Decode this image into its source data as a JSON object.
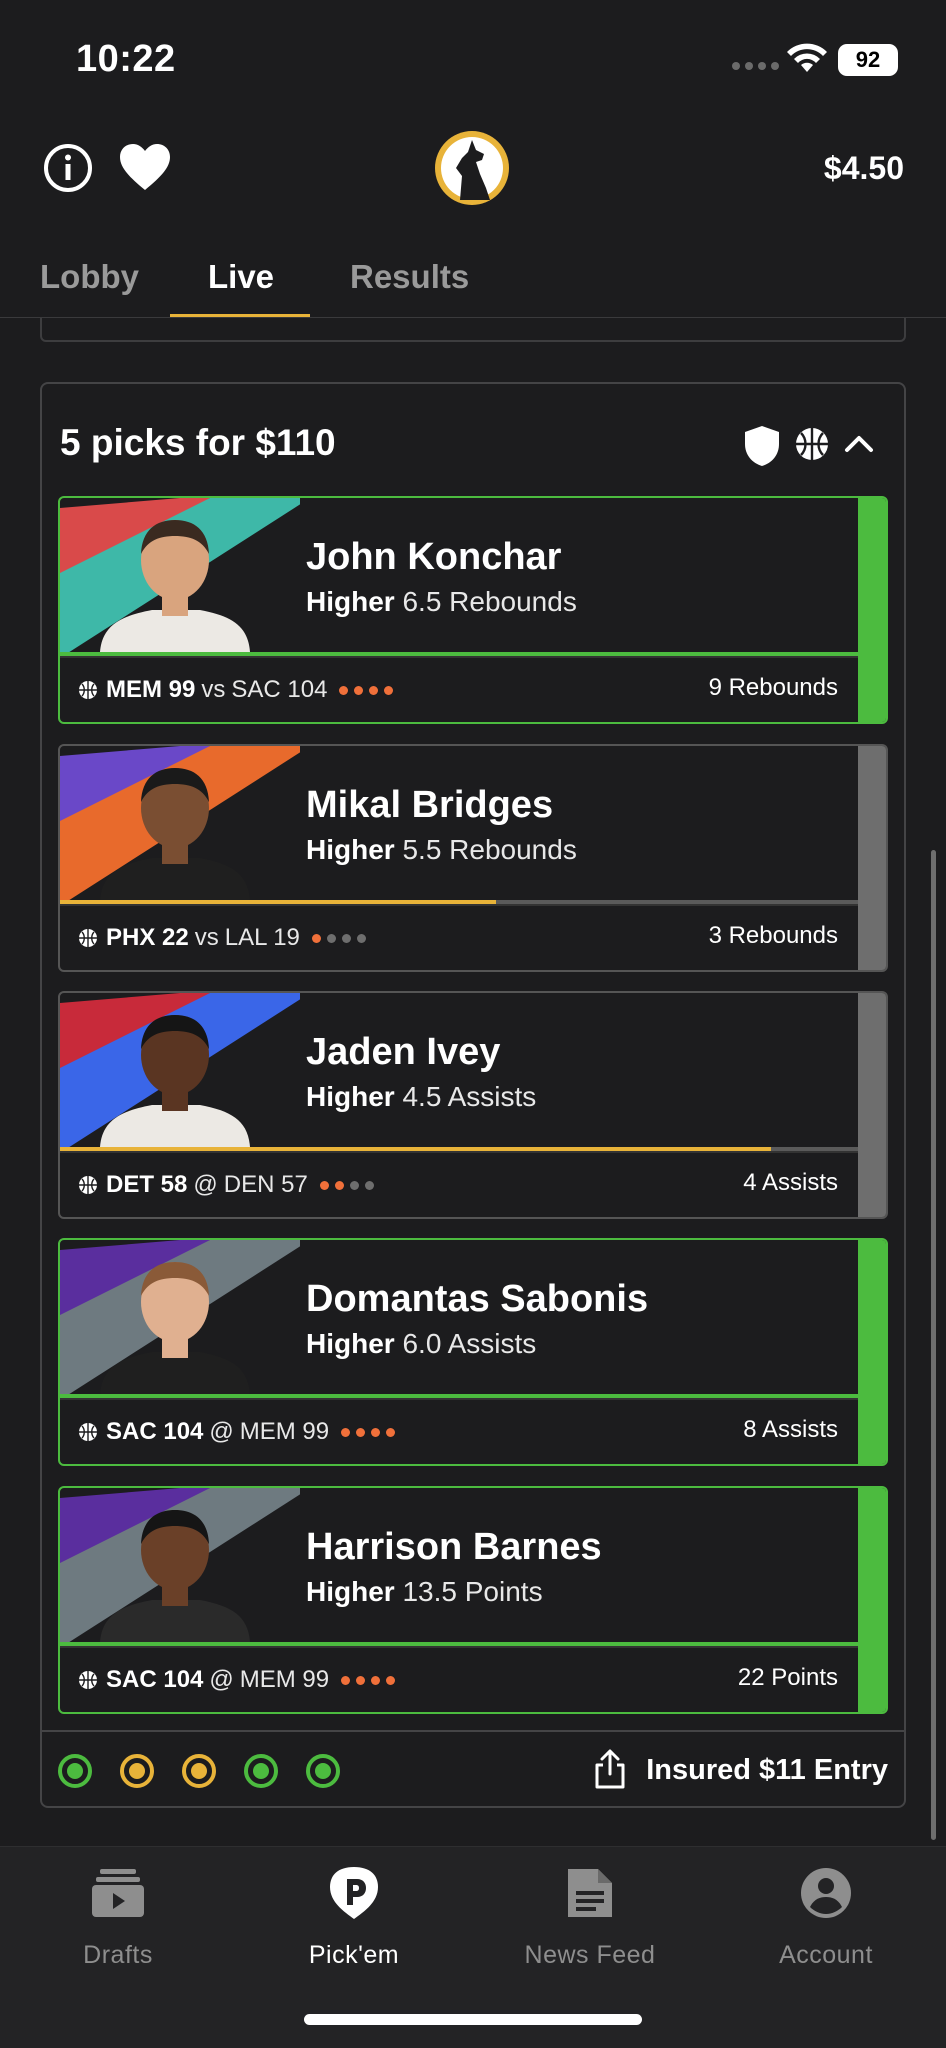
{
  "status_bar": {
    "time": "10:22",
    "battery": "92"
  },
  "header": {
    "balance": "$4.50"
  },
  "tabs": [
    {
      "label": "Lobby",
      "active": false
    },
    {
      "label": "Live",
      "active": true
    },
    {
      "label": "Results",
      "active": false
    }
  ],
  "entry": {
    "title": "5 picks for $110",
    "footer": {
      "insured_label": "Insured $11 Entry",
      "pick_statuses": [
        "won",
        "in-progress",
        "in-progress",
        "won",
        "won"
      ]
    },
    "picks": [
      {
        "player": "John Konchar",
        "direction": "Higher",
        "line": "6.5 Rebounds",
        "team": "MEM 99",
        "sep": "vs",
        "opp": "SAC 104",
        "period_dots_on": 4,
        "current_stat": "9 Rebounds",
        "progress": 1.0,
        "status": "won",
        "stripe_colors": [
          "#d94a4a",
          "#3eb8a8"
        ],
        "jersey_color": "#ece9e4",
        "skin_color": "#d9a47e",
        "hair_color": "#3a2a20"
      },
      {
        "player": "Mikal Bridges",
        "direction": "Higher",
        "line": "5.5 Rebounds",
        "team": "PHX 22",
        "sep": "vs",
        "opp": "LAL 19",
        "period_dots_on": 1,
        "current_stat": "3 Rebounds",
        "progress": 0.545,
        "status": "in-progress",
        "stripe_colors": [
          "#6a48c8",
          "#e86a2c"
        ],
        "jersey_color": "#1f1f1f",
        "skin_color": "#7a4e32",
        "hair_color": "#1a1a1a"
      },
      {
        "player": "Jaden Ivey",
        "direction": "Higher",
        "line": "4.5 Assists",
        "team": "DET 58",
        "sep": "@",
        "opp": "DEN 57",
        "period_dots_on": 2,
        "current_stat": "4 Assists",
        "progress": 0.889,
        "status": "in-progress",
        "stripe_colors": [
          "#c82a3a",
          "#3a66e8"
        ],
        "jersey_color": "#ece9e4",
        "skin_color": "#5a3522",
        "hair_color": "#151515"
      },
      {
        "player": "Domantas Sabonis",
        "direction": "Higher",
        "line": "6.0 Assists",
        "team": "SAC 104",
        "sep": "@",
        "opp": "MEM 99",
        "period_dots_on": 4,
        "current_stat": "8 Assists",
        "progress": 1.0,
        "status": "won",
        "stripe_colors": [
          "#5a2e9e",
          "#6e7a80"
        ],
        "jersey_color": "#1f1f1f",
        "skin_color": "#e0b090",
        "hair_color": "#8a5a38"
      },
      {
        "player": "Harrison Barnes",
        "direction": "Higher",
        "line": "13.5 Points",
        "team": "SAC 104",
        "sep": "@",
        "opp": "MEM 99",
        "period_dots_on": 4,
        "current_stat": "22 Points",
        "progress": 1.0,
        "status": "won",
        "stripe_colors": [
          "#5a2e9e",
          "#6e7a80"
        ],
        "jersey_color": "#2a2a2a",
        "skin_color": "#6a4028",
        "hair_color": "#151515"
      }
    ]
  },
  "bottom_nav": [
    {
      "label": "Drafts",
      "icon": "drafts-icon",
      "active": false
    },
    {
      "label": "Pick'em",
      "icon": "pickem-icon",
      "active": true
    },
    {
      "label": "News Feed",
      "icon": "news-feed-icon",
      "active": false
    },
    {
      "label": "Account",
      "icon": "account-icon",
      "active": false
    }
  ],
  "colors": {
    "accent": "#e8b339",
    "won": "#4cbb3f",
    "pending": "#6e6e6e",
    "period_dot": "#f0703a"
  }
}
